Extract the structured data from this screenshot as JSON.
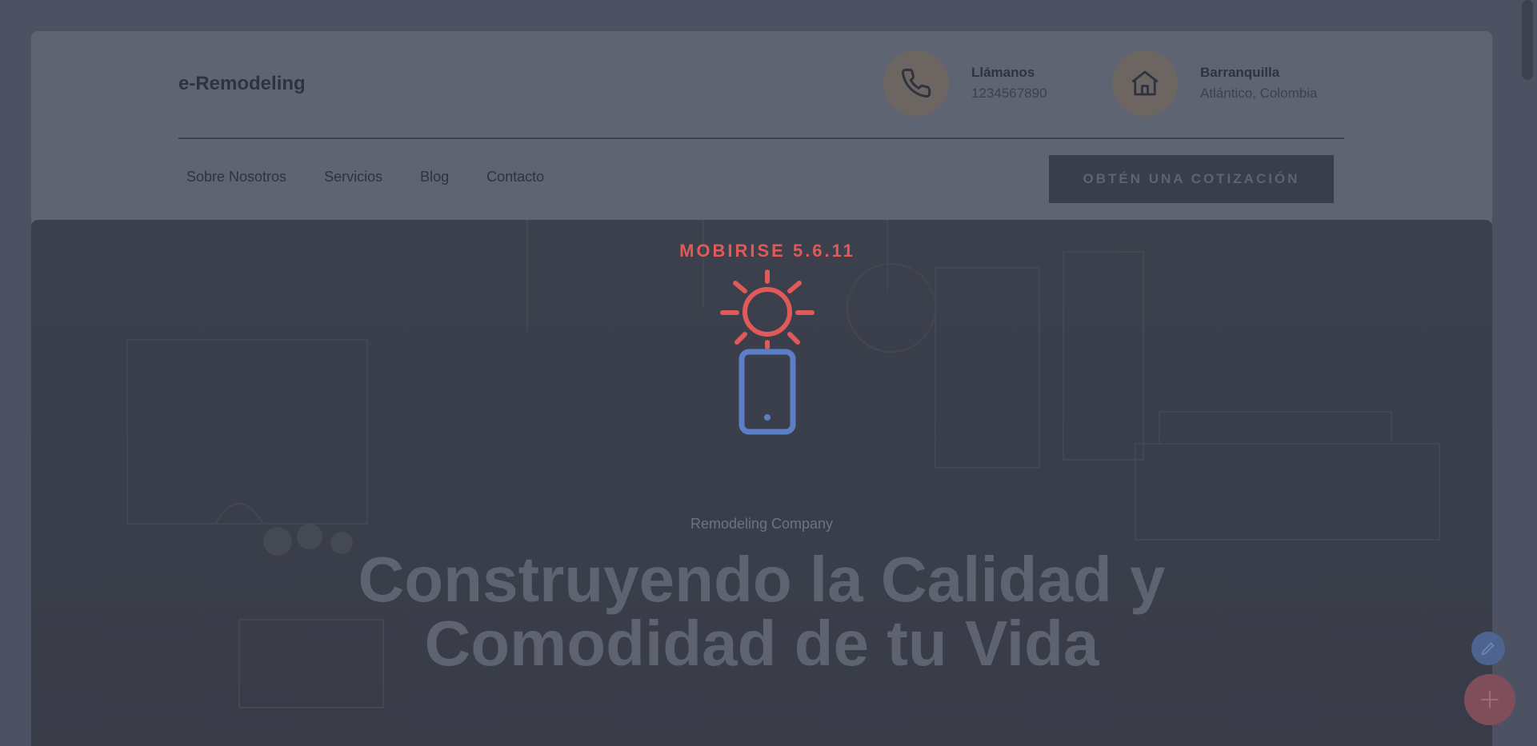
{
  "header": {
    "brand": "e-Remodeling",
    "phone": {
      "title": "Llámanos",
      "value": "1234567890",
      "icon": "phone-icon"
    },
    "location": {
      "title": "Barranquilla",
      "value": "Atlántico, Colombia",
      "icon": "home-icon"
    }
  },
  "nav": {
    "items": [
      "Sobre Nosotros",
      "Servicios",
      "Blog",
      "Contacto"
    ]
  },
  "cta": {
    "label": "OBTÉN UNA COTIZACIÓN"
  },
  "hero": {
    "badge": "MOBIRISE  5.6.11",
    "eyebrow": "Remodeling Company",
    "headline_line1": "Construyendo la Calidad y",
    "headline_line2": "Comodidad de tu Vida"
  },
  "fabs": {
    "edit_icon": "pencil-icon",
    "add_icon": "plus-icon"
  },
  "colors": {
    "accent_red": "#e05a5a",
    "accent_blue": "#5b7fc7",
    "overlay": "#4c5261"
  }
}
